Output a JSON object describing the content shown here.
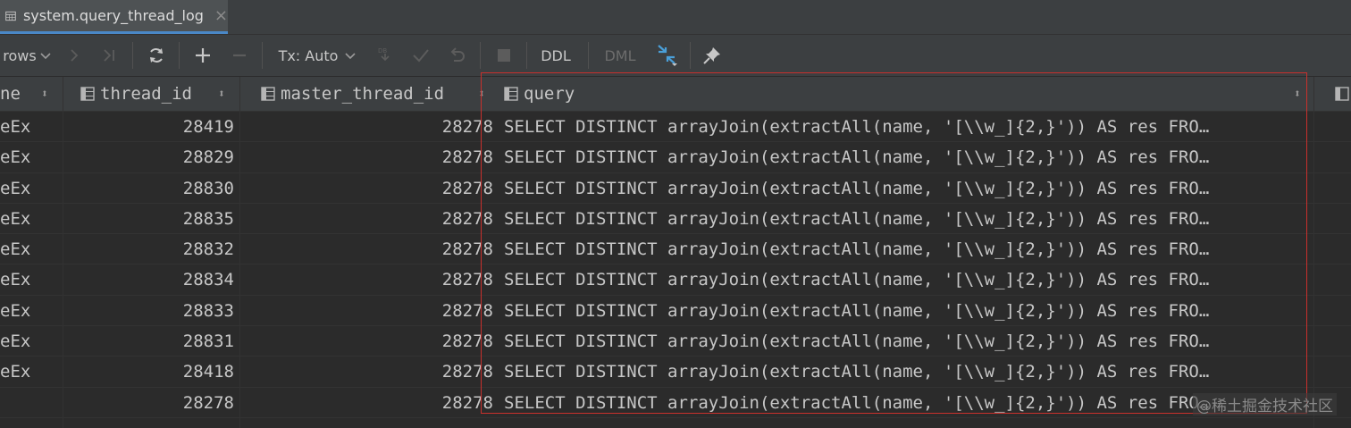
{
  "tab": {
    "title": "system.query_thread_log",
    "close": "×"
  },
  "toolbar": {
    "rows_label": "rows",
    "tx_label": "Tx: Auto",
    "ddl_label": "DDL",
    "dml_label": "DML",
    "icons": [
      "chevron-down-icon",
      "next-icon",
      "last-icon",
      "refresh-icon",
      "add-icon",
      "remove-icon",
      "db-icon",
      "commit-icon",
      "rollback-icon",
      "stop-icon",
      "compare-icon",
      "pin-icon"
    ]
  },
  "columns": {
    "partial": "ne",
    "thread_id": "thread_id",
    "master_thread_id": "master_thread_id",
    "query": "query"
  },
  "rows": [
    {
      "name": "eEx",
      "thread_id": "28419",
      "master_thread_id": "28278",
      "query": "SELECT DISTINCT arrayJoin(extractAll(name, '[\\\\w_]{2,}')) AS res FRO…"
    },
    {
      "name": "eEx",
      "thread_id": "28829",
      "master_thread_id": "28278",
      "query": "SELECT DISTINCT arrayJoin(extractAll(name, '[\\\\w_]{2,}')) AS res FRO…"
    },
    {
      "name": "eEx",
      "thread_id": "28830",
      "master_thread_id": "28278",
      "query": "SELECT DISTINCT arrayJoin(extractAll(name, '[\\\\w_]{2,}')) AS res FRO…"
    },
    {
      "name": "eEx",
      "thread_id": "28835",
      "master_thread_id": "28278",
      "query": "SELECT DISTINCT arrayJoin(extractAll(name, '[\\\\w_]{2,}')) AS res FRO…"
    },
    {
      "name": "eEx",
      "thread_id": "28832",
      "master_thread_id": "28278",
      "query": "SELECT DISTINCT arrayJoin(extractAll(name, '[\\\\w_]{2,}')) AS res FRO…"
    },
    {
      "name": "eEx",
      "thread_id": "28834",
      "master_thread_id": "28278",
      "query": "SELECT DISTINCT arrayJoin(extractAll(name, '[\\\\w_]{2,}')) AS res FRO…"
    },
    {
      "name": "eEx",
      "thread_id": "28833",
      "master_thread_id": "28278",
      "query": "SELECT DISTINCT arrayJoin(extractAll(name, '[\\\\w_]{2,}')) AS res FRO…"
    },
    {
      "name": "eEx",
      "thread_id": "28831",
      "master_thread_id": "28278",
      "query": "SELECT DISTINCT arrayJoin(extractAll(name, '[\\\\w_]{2,}')) AS res FRO…"
    },
    {
      "name": "eEx",
      "thread_id": "28418",
      "master_thread_id": "28278",
      "query": "SELECT DISTINCT arrayJoin(extractAll(name, '[\\\\w_]{2,}')) AS res FRO…"
    },
    {
      "name": "",
      "thread_id": "28278",
      "master_thread_id": "28278",
      "query": "SELECT DISTINCT arrayJoin(extractAll(name, '[\\\\w_]{2,}')) AS res FRO…"
    }
  ],
  "watermark": "@稀土掘金技术社区",
  "colors": {
    "background": "#2b2b2b",
    "header": "#3c3f41",
    "highlight": "#c9302c",
    "accent": "#4a88c7"
  }
}
